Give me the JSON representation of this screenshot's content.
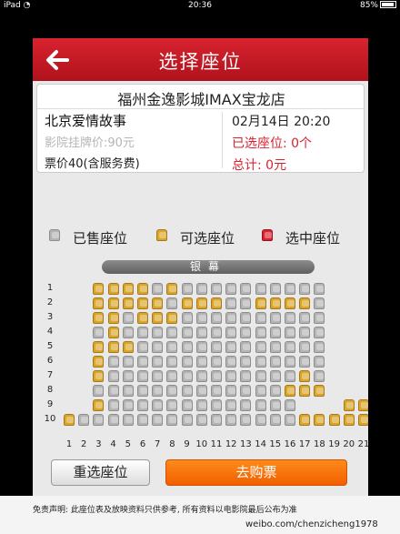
{
  "status_bar": {
    "device": "iPad",
    "wifi_icon": "wifi-icon",
    "time": "20:36",
    "battery": "85%"
  },
  "header": {
    "title": "选择座位",
    "back_icon": "back-arrow-icon"
  },
  "info": {
    "cinema": "福州金逸影城IMAX宝龙店",
    "movie": "北京爱情故事",
    "listed_price": "影院挂牌价:90元",
    "ticket_price": "票价40(含服务费)",
    "datetime": "02月14日 20:20",
    "selected_seats": "已选座位: 0个",
    "total": "总计: 0元"
  },
  "legend": [
    {
      "label": "已售座位",
      "state": "sold"
    },
    {
      "label": "可选座位",
      "state": "available"
    },
    {
      "label": "选中座位",
      "state": "selected"
    }
  ],
  "screen_label": "银幕",
  "seat_map": {
    "rows": [
      "1",
      "2",
      "3",
      "4",
      "5",
      "6",
      "7",
      "8",
      "9",
      "10"
    ],
    "cols": [
      "1",
      "2",
      "3",
      "4",
      "5",
      "6",
      "7",
      "8",
      "9",
      "10",
      "11",
      "12",
      "13",
      "14",
      "15",
      "16",
      "17",
      "18",
      "19",
      "20",
      "21"
    ],
    "colors": {
      "sold": "#b4b4b4",
      "available": "#d8a72a",
      "selected": "#d8232f"
    },
    "grid": [
      "..aaaasassssssssss...",
      "..aaaaasaaassaaaas...",
      "..aasaaassssssssss...",
      "..sassssssssssssss...",
      "..aaasssssssssssss...",
      "..asssssssssssssss...",
      "..asssssssssssssas...",
      "..sssssssssssssaaa...",
      "..asssssssssssss...aa.",
      "asssssssssssssssaaaaa"
    ]
  },
  "buttons": {
    "reset": "重选座位",
    "buy": "去购票"
  },
  "footer": {
    "disclaimer": "免责声明: 此座位表及放映资料只供参考, 所有资料以电影院最后公布为准",
    "watermark": "weibo.com/chenzicheng1978"
  }
}
